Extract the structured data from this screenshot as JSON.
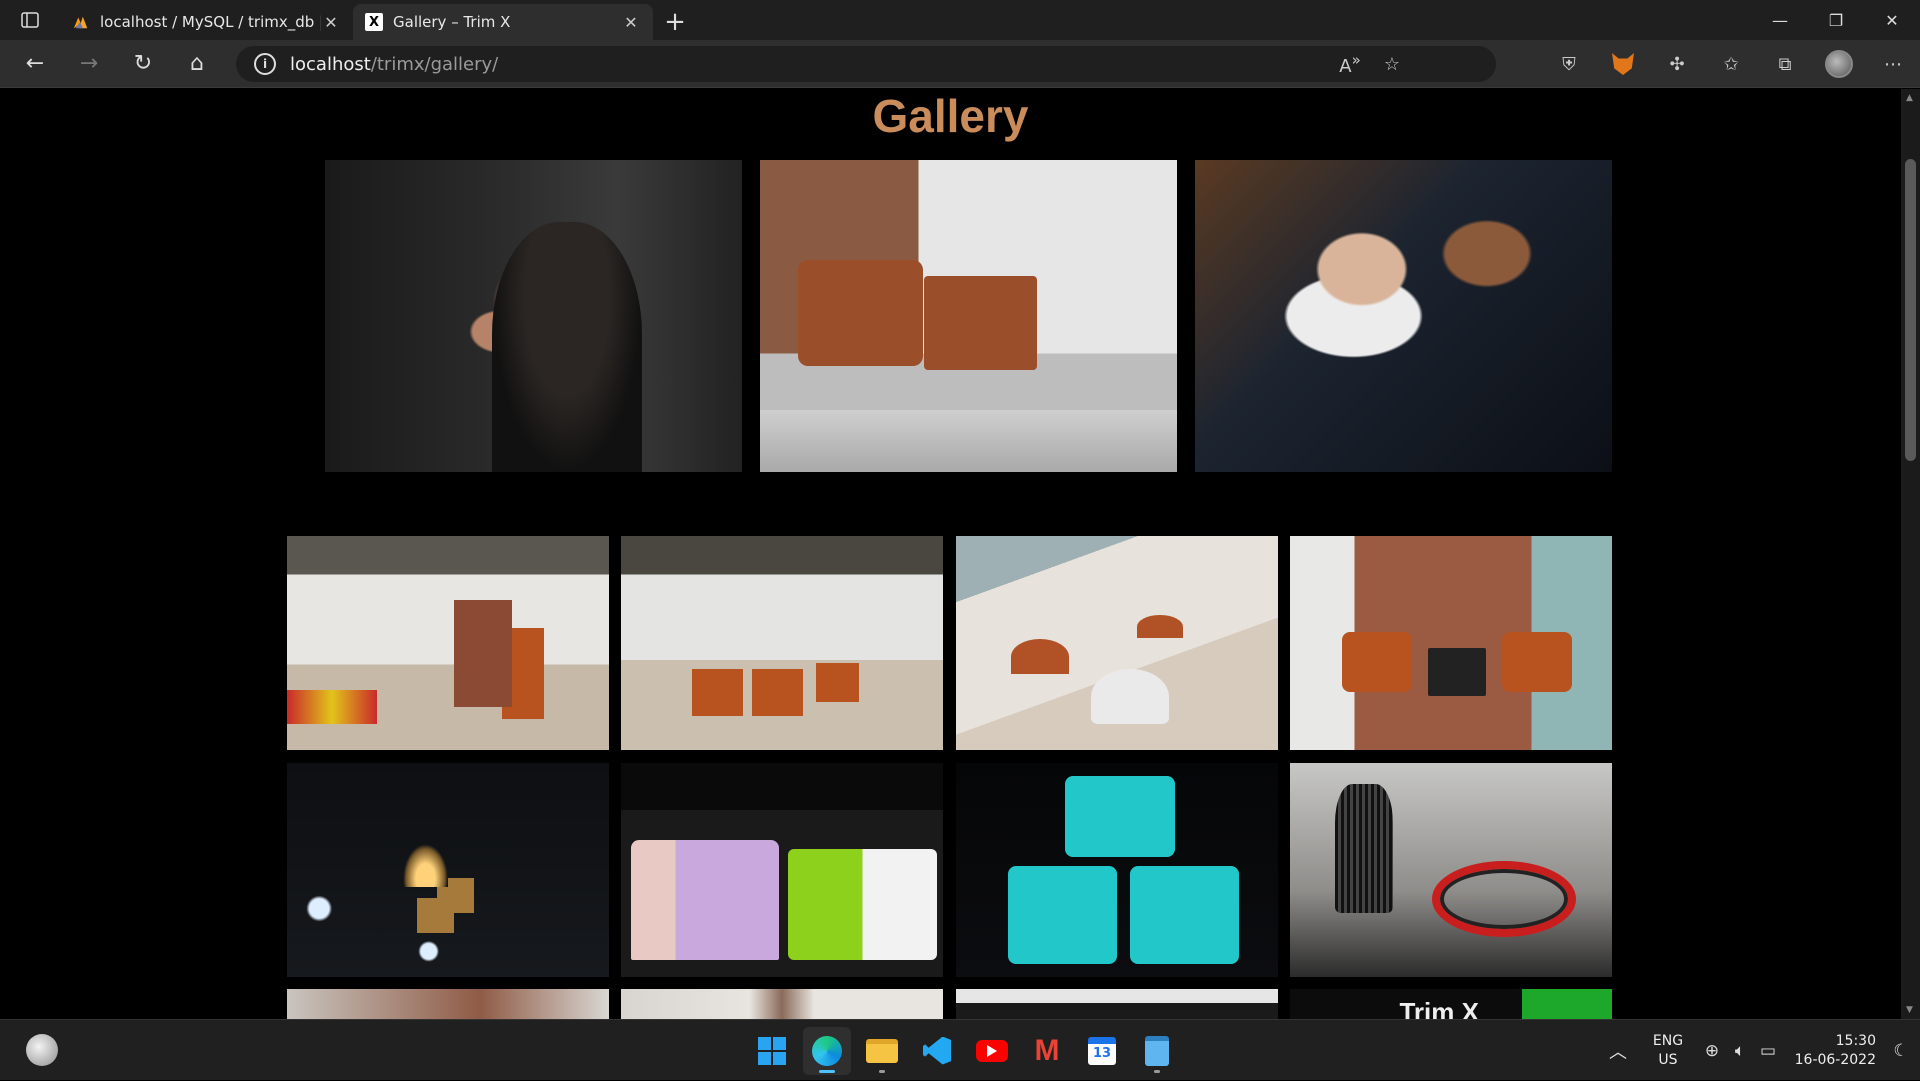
{
  "browser": {
    "tabs": [
      {
        "title": "localhost / MySQL / trimx_db | p",
        "favicon": "phpmyadmin-icon",
        "active": false
      },
      {
        "title": "Gallery – Trim X",
        "favicon_text": "X",
        "active": true
      }
    ],
    "address": {
      "host": "localhost",
      "path": "/trimx/gallery/"
    }
  },
  "page": {
    "heading": "Gallery",
    "heading_color": "#c98c5a",
    "background": "#000000",
    "featured_photos": [
      {
        "name": "barber-haircut-photo"
      },
      {
        "name": "salon-wash-station-photo"
      },
      {
        "name": "barber-shave-photo"
      }
    ],
    "grid_rows": [
      [
        "salon-interior-photo-1",
        "salon-interior-photo-2",
        "salon-interior-photo-3",
        "salon-interior-photo-4"
      ],
      [
        "pendant-lights-photo",
        "hair-products-shelf-photo",
        "hair-mask-jars-photo",
        "comb-and-scissors-photo"
      ],
      [
        "partial-photo-1",
        "partial-photo-2",
        "partial-photo-3",
        "trim-x-sign-photo"
      ]
    ],
    "sign_text": "Trim X"
  },
  "taskbar": {
    "apps": [
      "start",
      "edge",
      "file-explorer",
      "vscode",
      "youtube",
      "gmail",
      "calendar",
      "notepad"
    ],
    "calendar_day": "13",
    "language": "ENG",
    "region": "US",
    "time": "15:30",
    "date": "16-06-2022"
  }
}
